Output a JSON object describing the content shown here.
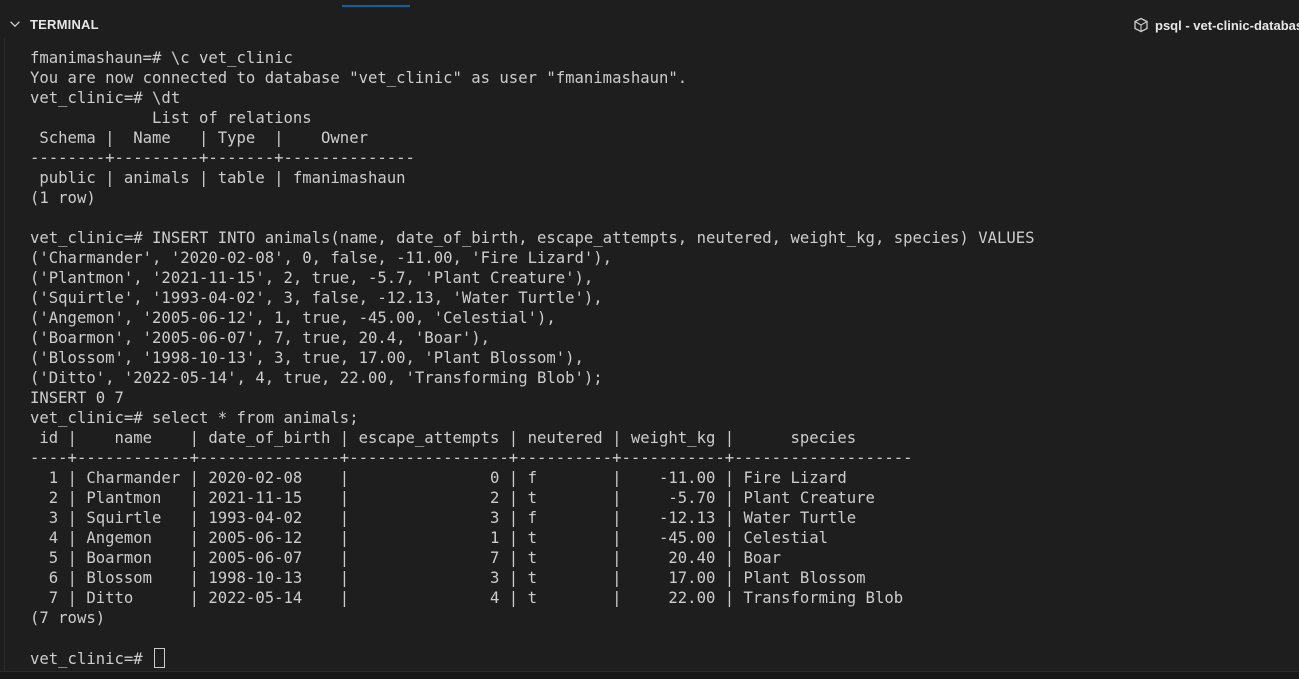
{
  "panel": {
    "title": "TERMINAL",
    "tab_label": "psql - vet-clinic-database"
  },
  "terminal": {
    "lines": [
      "fmanimashaun=# \\c vet_clinic",
      "You are now connected to database \"vet_clinic\" as user \"fmanimashaun\".",
      "vet_clinic=# \\dt",
      "             List of relations",
      " Schema |  Name   | Type  |    Owner",
      "--------+---------+-------+--------------",
      " public | animals | table | fmanimashaun",
      "(1 row)",
      "",
      "vet_clinic=# INSERT INTO animals(name, date_of_birth, escape_attempts, neutered, weight_kg, species) VALUES",
      "('Charmander', '2020-02-08', 0, false, -11.00, 'Fire Lizard'),",
      "('Plantmon', '2021-11-15', 2, true, -5.7, 'Plant Creature'),",
      "('Squirtle', '1993-04-02', 3, false, -12.13, 'Water Turtle'),",
      "('Angemon', '2005-06-12', 1, true, -45.00, 'Celestial'),",
      "('Boarmon', '2005-06-07', 7, true, 20.4, 'Boar'),",
      "('Blossom', '1998-10-13', 3, true, 17.00, 'Plant Blossom'),",
      "('Ditto', '2022-05-14', 4, true, 22.00, 'Transforming Blob');",
      "INSERT 0 7",
      "vet_clinic=# select * from animals;",
      " id |    name    | date_of_birth | escape_attempts | neutered | weight_kg |      species",
      "----+------------+---------------+-----------------+----------+-----------+-------------------",
      "  1 | Charmander | 2020-02-08    |               0 | f        |    -11.00 | Fire Lizard",
      "  2 | Plantmon   | 2021-11-15    |               2 | t        |     -5.70 | Plant Creature",
      "  3 | Squirtle   | 1993-04-02    |               3 | f        |    -12.13 | Water Turtle",
      "  4 | Angemon    | 2005-06-12    |               1 | t        |    -45.00 | Celestial",
      "  5 | Boarmon    | 2005-06-07    |               7 | t        |     20.40 | Boar",
      "  6 | Blossom    | 1998-10-13    |               3 | t        |     17.00 | Plant Blossom",
      "  7 | Ditto      | 2022-05-14    |               4 | t        |     22.00 | Transforming Blob",
      "(7 rows)",
      ""
    ],
    "prompt": "vet_clinic=# "
  }
}
